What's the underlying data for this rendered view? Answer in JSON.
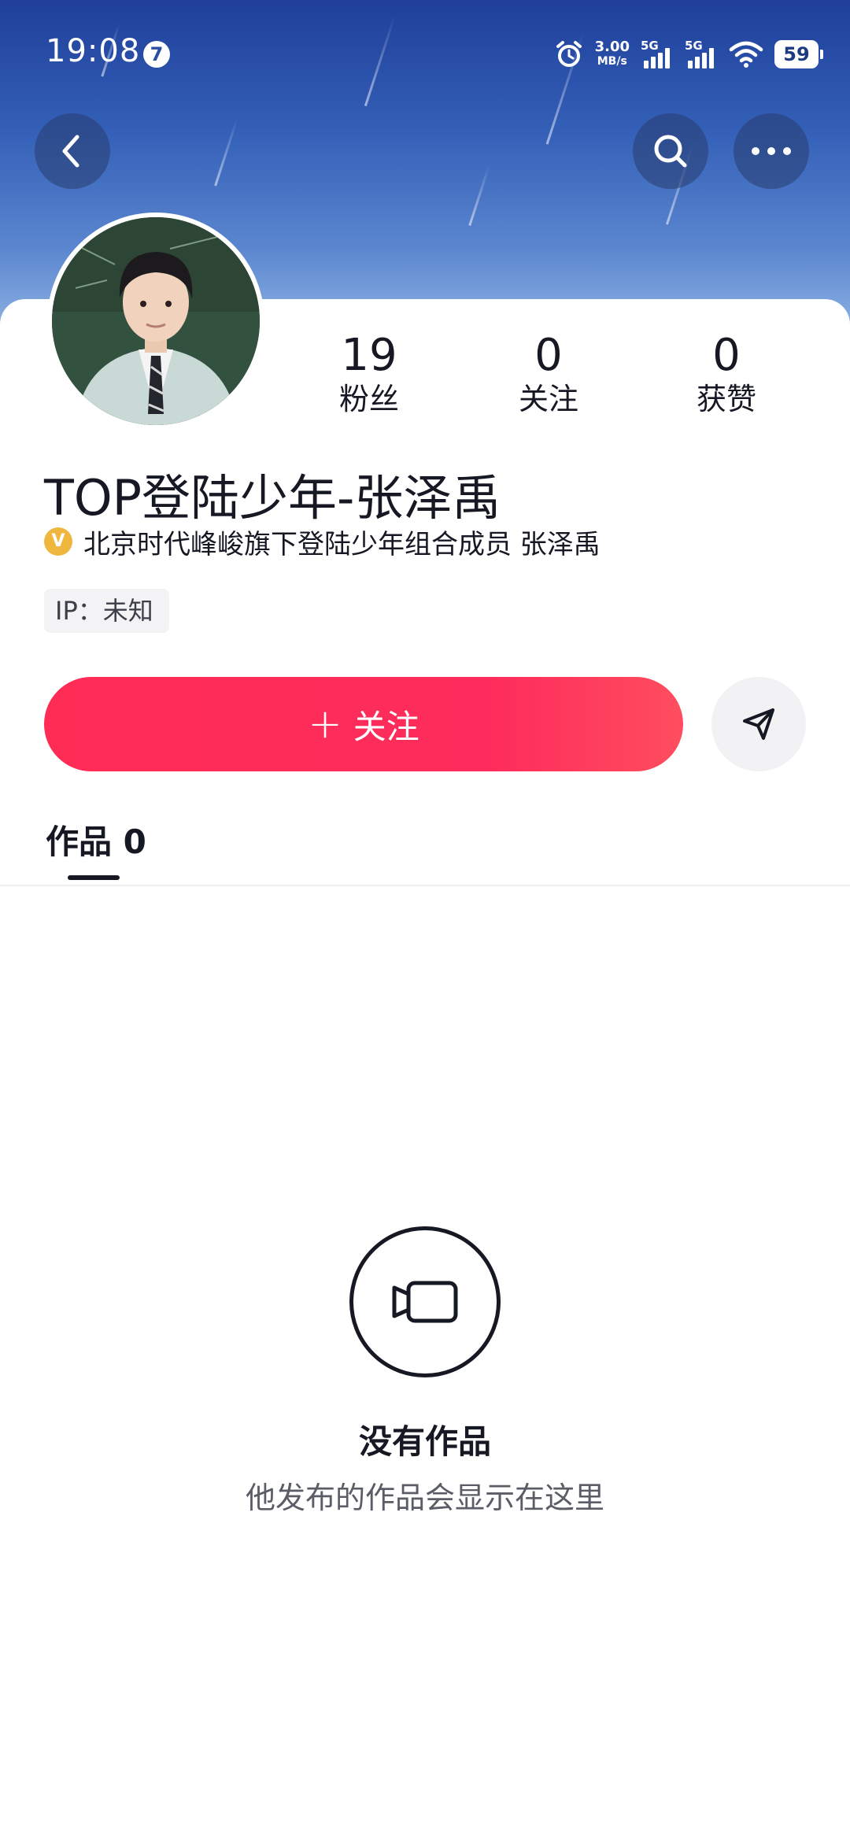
{
  "status_bar": {
    "time": "19:08",
    "notification_count": "7",
    "net_speed_value": "3.00",
    "net_speed_unit": "MB/s",
    "signal_1_label": "5G",
    "signal_2_label": "5G",
    "battery": "59",
    "icons": [
      "alarm-icon",
      "signal-icon",
      "signal-icon",
      "wifi-icon",
      "battery-icon"
    ]
  },
  "nav": {
    "back_icon": "chevron-left-icon",
    "search_icon": "search-icon",
    "more_icon": "more-dots-icon"
  },
  "profile": {
    "name": "TOP登陆少年-张泽禹",
    "verification": "北京时代峰峻旗下登陆少年组合成员 张泽禹",
    "verify_badge": "V",
    "ip": "IP：未知",
    "stats": [
      {
        "value": "19",
        "label": "粉丝"
      },
      {
        "value": "0",
        "label": "关注"
      },
      {
        "value": "0",
        "label": "获赞"
      }
    ]
  },
  "actions": {
    "follow_plus": "+",
    "follow_label": "关注",
    "share_icon": "send-icon",
    "follow_color": "#fe2c55"
  },
  "tabs": {
    "works_label": "作品 0"
  },
  "empty_state": {
    "icon": "video-camera-icon",
    "title": "没有作品",
    "subtitle": "他发布的作品会显示在这里"
  }
}
